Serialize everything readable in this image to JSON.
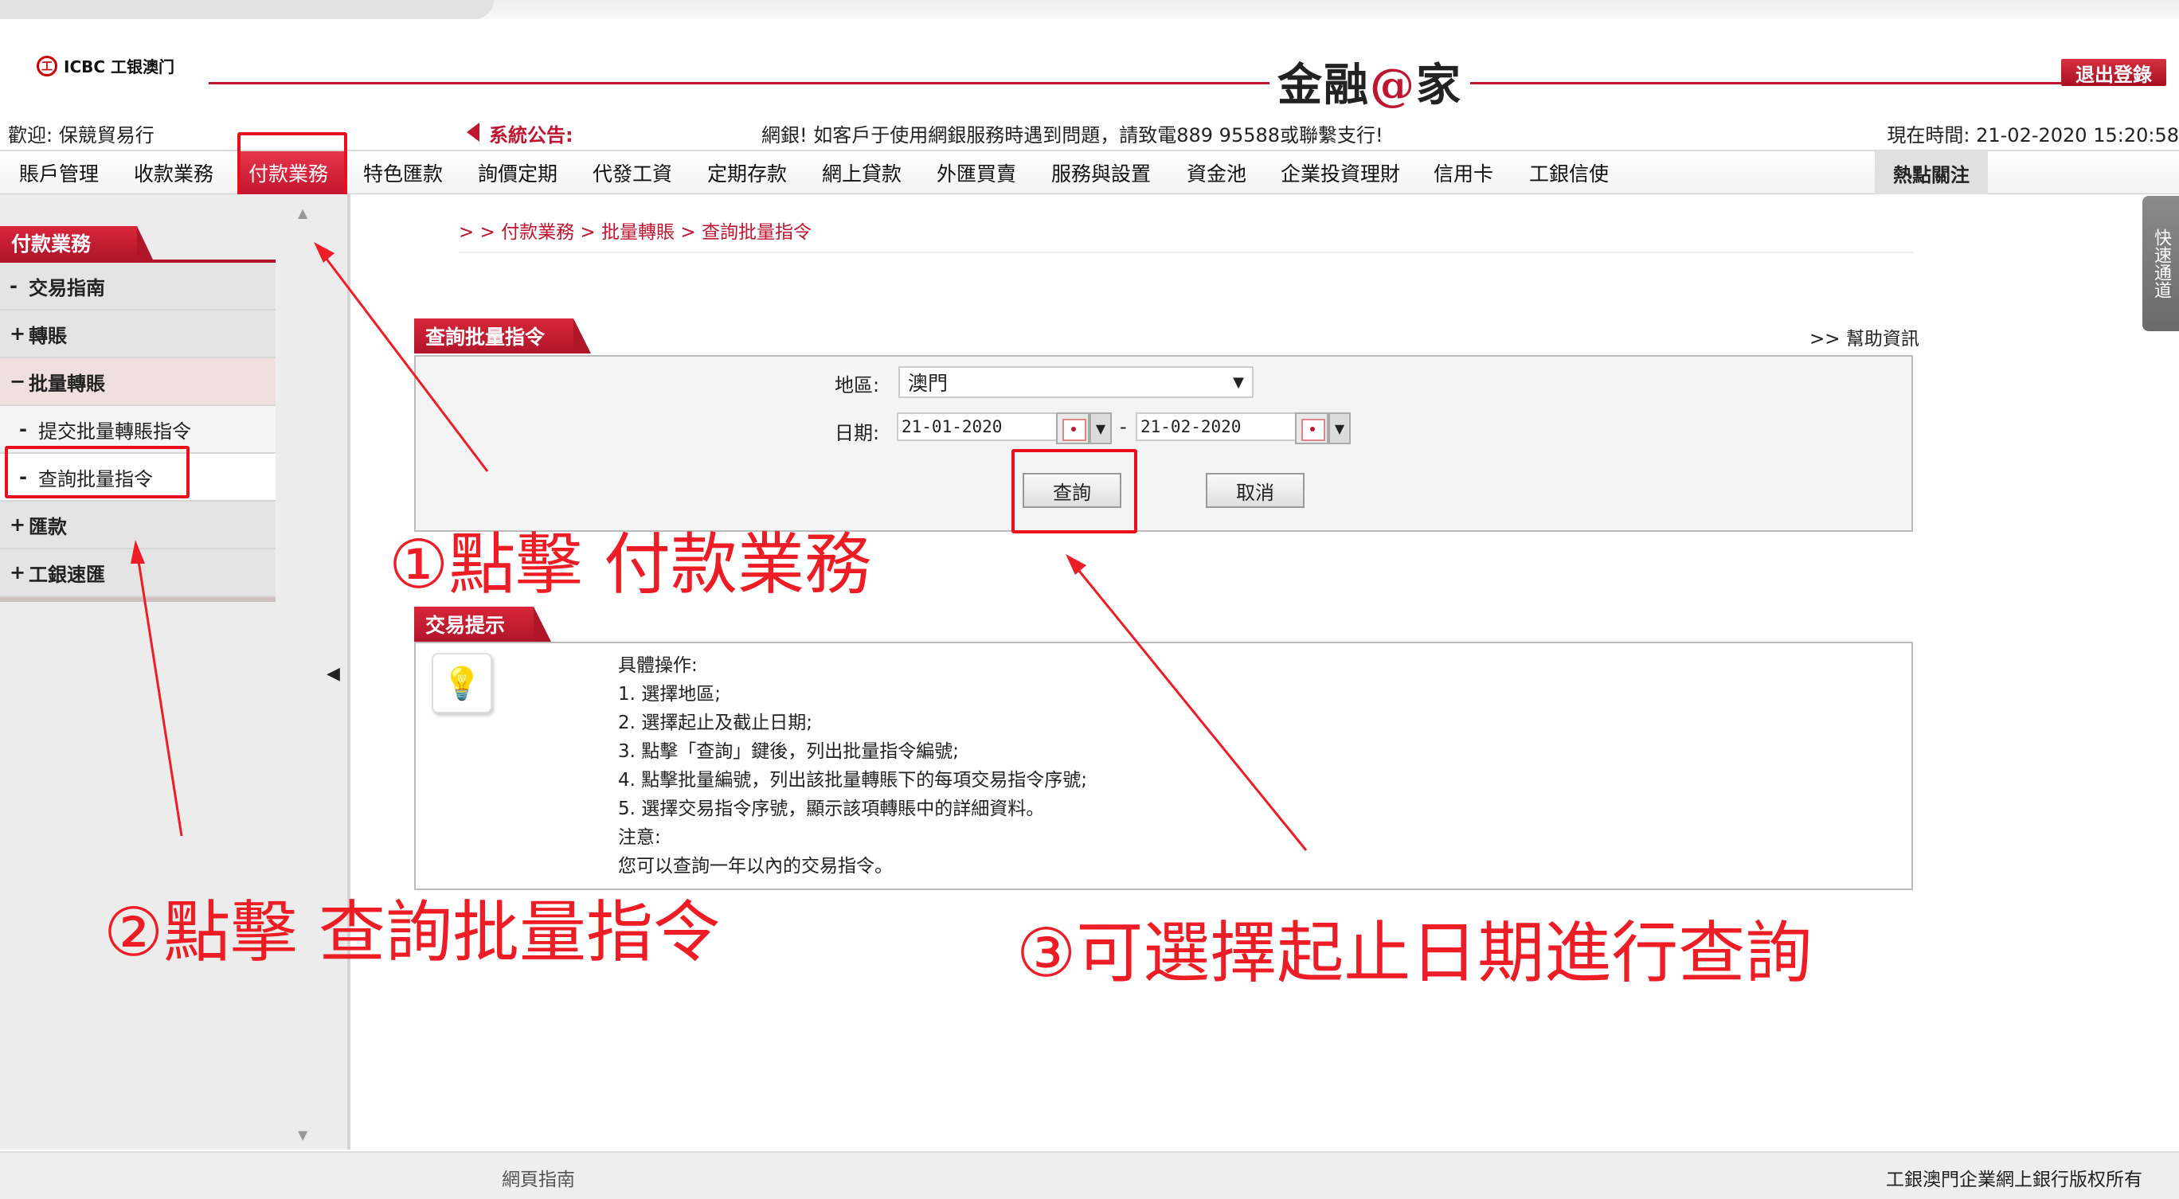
{
  "header": {
    "logo_text": "ICBC 工银澳门",
    "logo_seal": "工",
    "brand_pre": "金融",
    "brand_at": "@",
    "brand_post": "家",
    "logout_label": "退出登錄"
  },
  "infobar": {
    "welcome": "歡迎:  保競貿易行",
    "notice_label": "系統公告:",
    "notice_text": "網銀!    如客戶于使用網銀服務時遇到問題，請致電889 95588或聯繫支行!",
    "time": "現在時間:   21-02-2020 15:20:58"
  },
  "nav": {
    "items": [
      "賬戶管理",
      "收款業務",
      "付款業務",
      "特色匯款",
      "詢價定期",
      "代發工資",
      "定期存款",
      "網上貸款",
      "外匯買賣",
      "服務與設置",
      "資金池",
      "企業投資理財",
      "信用卡",
      "工銀信使"
    ],
    "active_index": 2,
    "hot_label": "熱點關注"
  },
  "sidebar": {
    "header": "付款業務",
    "items": [
      {
        "pm": "-",
        "label": "交易指南"
      },
      {
        "pm": "+",
        "label": "轉賬"
      },
      {
        "pm": "−",
        "label": "批量轉賬"
      },
      {
        "pm": "-",
        "label": "提交批量轉賬指令"
      },
      {
        "pm": "-",
        "label": "查詢批量指令"
      },
      {
        "pm": "+",
        "label": "匯款"
      },
      {
        "pm": "+",
        "label": "工銀速匯"
      }
    ]
  },
  "breadcrumb": "> > 付款業務 > 批量轉賬 > 查詢批量指令",
  "query_panel": {
    "title": "查詢批量指令",
    "help_link": ">> 幫助資訊",
    "region_label": "地區:",
    "region_value": "澳門",
    "date_label": "日期:",
    "date_from": "21-01-2020",
    "date_to": "21-02-2020",
    "date_sep": "-",
    "query_button": "查詢",
    "cancel_button": "取消"
  },
  "tips_panel": {
    "title": "交易提示",
    "lines": [
      "具體操作:",
      "1. 選擇地區;",
      "2. 選擇起止及截止日期;",
      "3. 點擊「查詢」鍵後，列出批量指令編號;",
      "4. 點擊批量編號，列出該批量轉賬下的每項交易指令序號;",
      "5. 選擇交易指令序號，顯示該項轉賬中的詳細資料。",
      "注意:",
      "您可以查詢一年以內的交易指令。"
    ]
  },
  "quick_access": "快速通道",
  "annotations": {
    "step1": "①點擊 付款業務",
    "step2": "②點擊 查詢批量指令",
    "step3": "③可選擇起止日期進行查詢",
    "color": "#ee1c24"
  },
  "footer": {
    "guide": "網頁指南",
    "copyright": "工銀澳門企業網上銀行版权所有"
  },
  "colors": {
    "brand_red": "#c0152f",
    "highlight_red": "#e8101e"
  }
}
